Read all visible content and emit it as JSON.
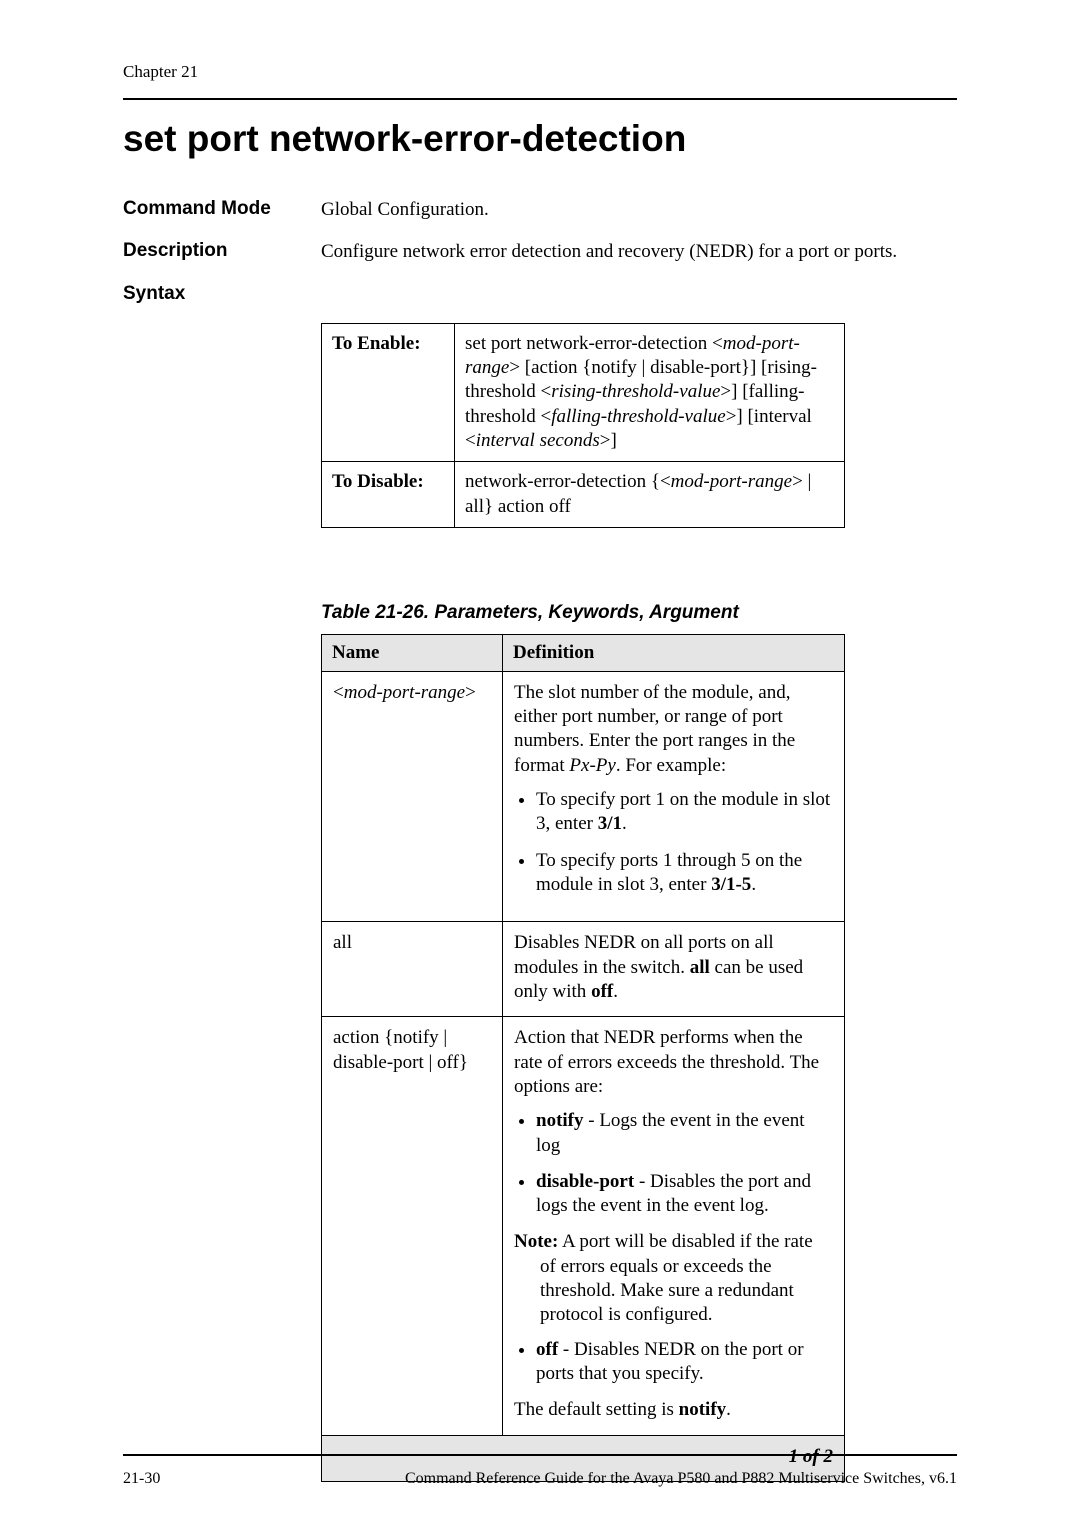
{
  "header": {
    "chapter": "Chapter 21"
  },
  "title": "set port network-error-detection",
  "rows": {
    "command_mode_label": "Command Mode",
    "command_mode_text": "Global Configuration.",
    "description_label": "Description",
    "description_text": "Configure network error detection and recovery (NEDR) for a port or ports.",
    "syntax_label": "Syntax"
  },
  "syntax": {
    "enable_label": "To Enable:",
    "enable_p1_a": "set port network-error-detection <",
    "enable_p1_b": "mod-port-range",
    "enable_p1_c": "> [action {notify | disable-port}] [rising-threshold <",
    "enable_p1_d": "rising-threshold-value",
    "enable_p1_e": ">] [falling-threshold <",
    "enable_p1_f": "falling-threshold-value",
    "enable_p1_g": ">] [interval <",
    "enable_p1_h": "interval seconds",
    "enable_p1_i": ">]",
    "disable_label": "To Disable:",
    "disable_a": "network-error-detection {<",
    "disable_b": "mod-port-range",
    "disable_c": "> | all} action off"
  },
  "param_caption": "Table 21-26. Parameters, Keywords, Argument",
  "param_headers": {
    "name": "Name",
    "definition": "Definition"
  },
  "param_rows": {
    "r1": {
      "name_a": "<",
      "name_b": "mod-port-range",
      "name_c": ">",
      "def_intro_a": "The slot number of the module, and, either port number, or range of port numbers. Enter the port ranges in the format ",
      "def_intro_b": "Px-Py",
      "def_intro_c": ". For example:",
      "b1_a": "To specify port 1 on the module in slot 3, enter ",
      "b1_b": "3/1",
      "b1_c": ".",
      "b2_a": "To specify ports 1 through 5 on the module in slot 3, enter ",
      "b2_b": "3/1-5",
      "b2_c": "."
    },
    "r2": {
      "name": "all",
      "def_a": "Disables NEDR on all ports on all modules in the switch. ",
      "def_b": "all",
      "def_c": " can be used only with ",
      "def_d": "off",
      "def_e": "."
    },
    "r3": {
      "name": "action {notify | disable-port | off}",
      "def_intro": "Action that NEDR performs when the rate of errors exceeds the threshold. The options are:",
      "b1_a": "notify",
      "b1_b": " - Logs the event in the event log",
      "b2_a": "disable-port",
      "b2_b": " - Disables the port and logs the event in the event log.",
      "note_a": "Note:",
      "note_b": " A port will be disabled if the rate of errors equals or exceeds the threshold. Make sure a redundant protocol is configured.",
      "b3_a": "off",
      "b3_b": " - Disables NEDR on the port or ports that you specify.",
      "default_a": "The default setting is ",
      "default_b": "notify",
      "default_c": "."
    }
  },
  "pager": "1 of 2",
  "footer": {
    "left": "21-30",
    "right": "Command Reference Guide for the Avaya P580 and P882 Multiservice Switches, v6.1"
  }
}
